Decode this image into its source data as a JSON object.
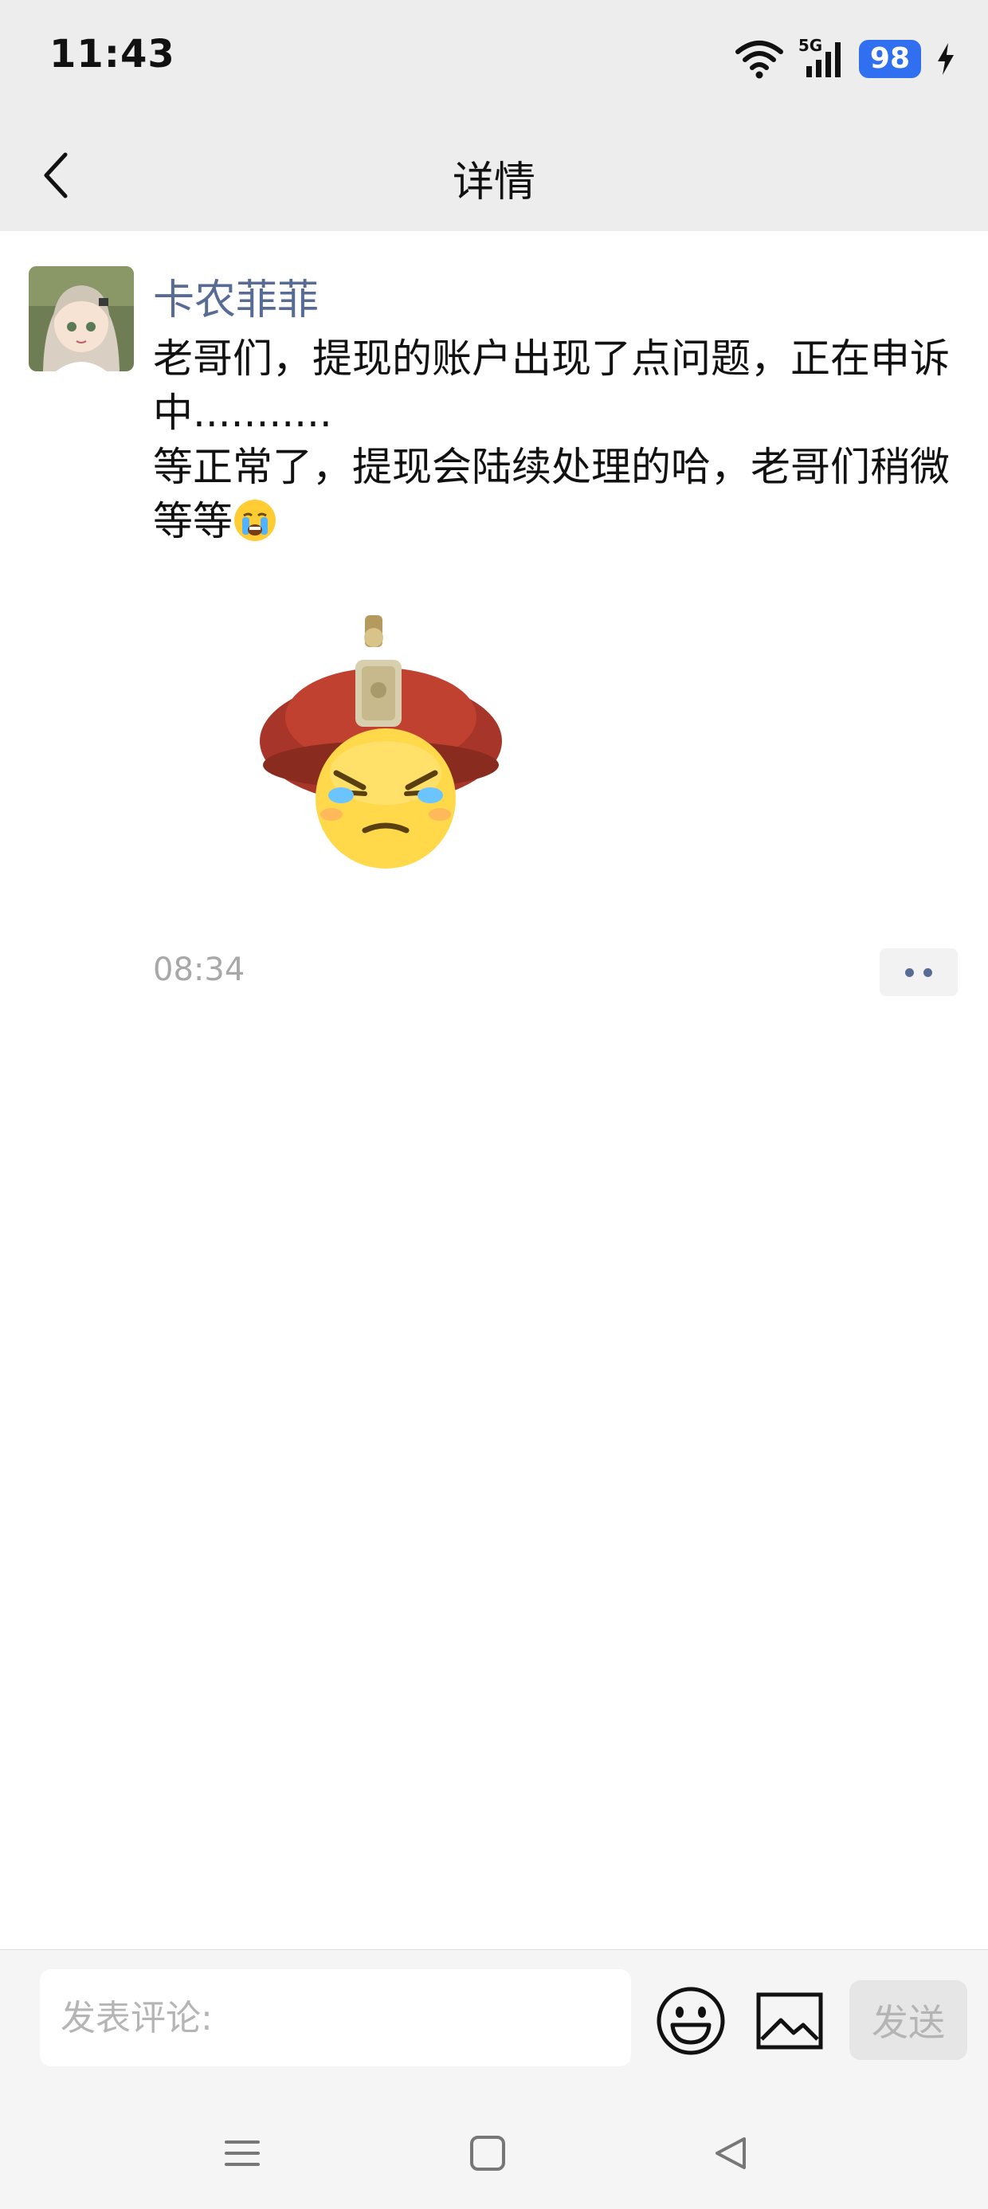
{
  "status_bar": {
    "time": "11:43",
    "network": "5G",
    "battery": "98",
    "icons": [
      "wifi-icon",
      "signal-icon",
      "battery-icon",
      "charging-icon"
    ]
  },
  "header": {
    "title": "详情",
    "back_icon": "chevron-left-icon"
  },
  "post": {
    "author": "卡农菲菲",
    "text_line1": "老哥们，提现的账户出现了点问题，正在申诉中...........",
    "text_line2": "等正常了，提现会陆续处理的哈，老哥们稍微等等",
    "inline_emoji": "crying-emoji",
    "sticker": "emperor-hat-crying-sticker",
    "time": "08:34",
    "more_icon": "more-dots-icon"
  },
  "comment_bar": {
    "placeholder": "发表评论:",
    "emoji_icon": "smiley-icon",
    "image_icon": "image-icon",
    "send_label": "发送"
  },
  "nav_bar": {
    "icons": [
      "menu-icon",
      "home-square-icon",
      "back-triangle-icon"
    ]
  },
  "colors": {
    "header_bg": "#ededed",
    "username": "#576b95",
    "battery": "#2f6ff0",
    "timestamp": "#a8a8a8"
  }
}
